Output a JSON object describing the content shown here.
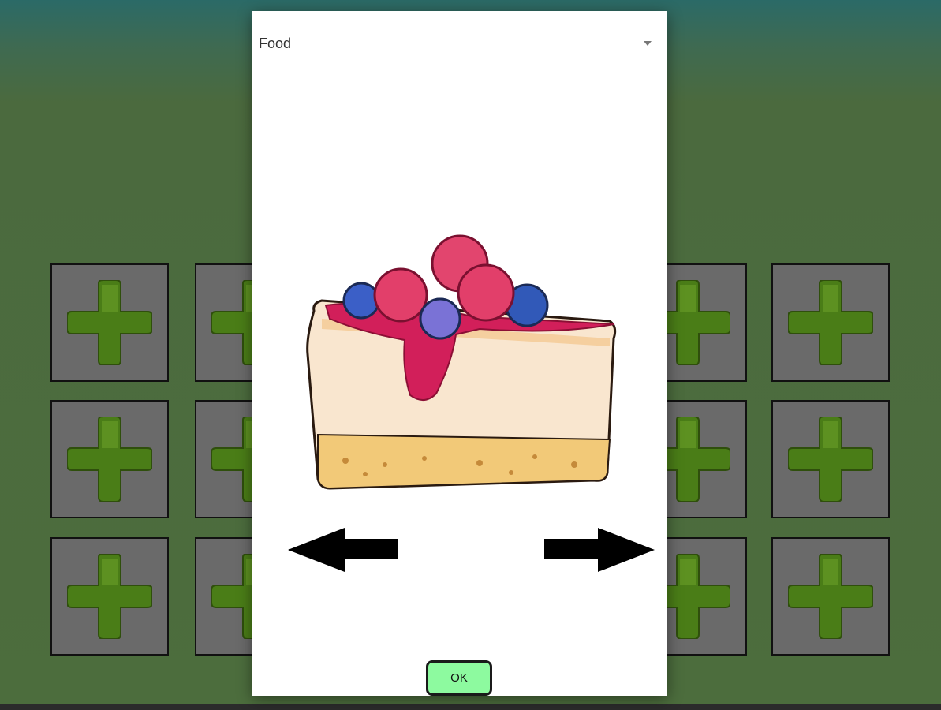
{
  "dialog": {
    "category_selected": "Food",
    "preview_image": "cheesecake-slice-with-berries",
    "prev_icon": "arrow-left-icon",
    "next_icon": "arrow-right-icon",
    "ok_label": "OK"
  },
  "background_grid": {
    "tile_icon": "add-plus-icon"
  },
  "colors": {
    "ok_button": "#8dfa9f",
    "tile_bg": "#6a6a6a",
    "plus_green": "#4a7d17",
    "background_top": "#2b6a67",
    "background_bottom": "#4c6d3d"
  }
}
